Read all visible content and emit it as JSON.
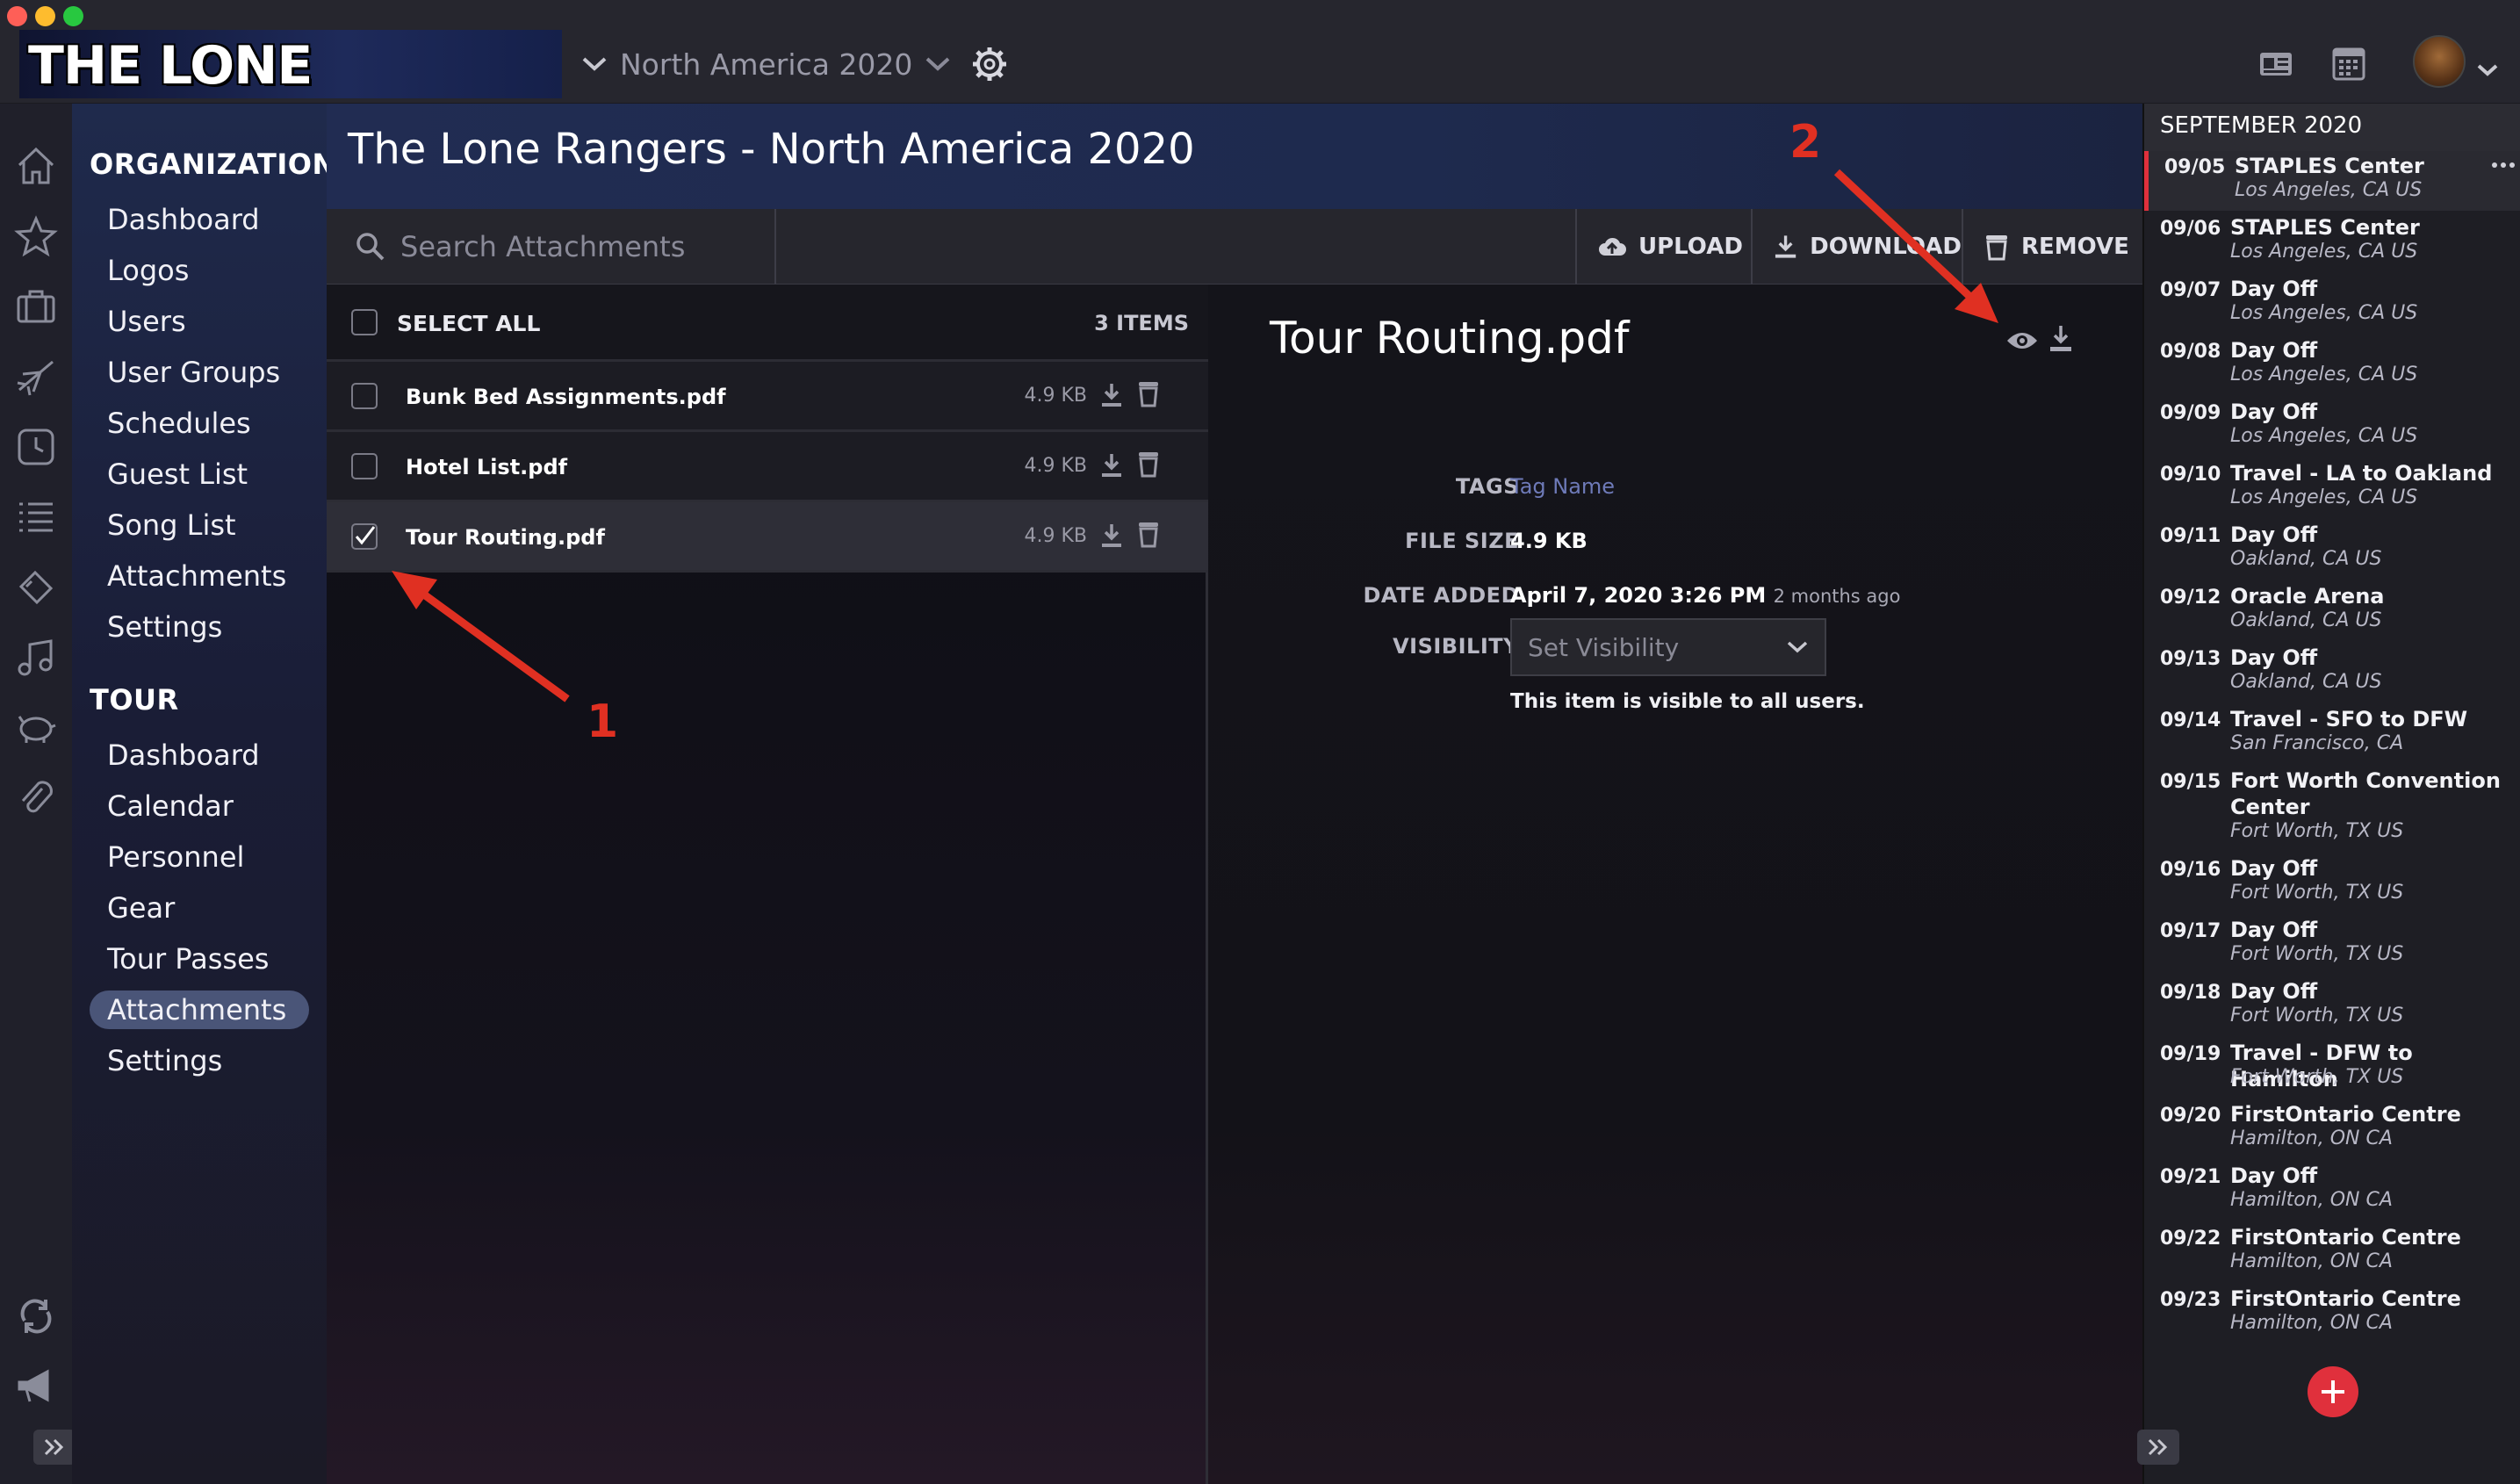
{
  "app": {
    "logo_text": "THE LONE RANGERS",
    "tour_selector": "North America 2020"
  },
  "nav": {
    "organization_heading": "ORGANIZATION",
    "organization_items": [
      "Dashboard",
      "Logos",
      "Users",
      "User Groups",
      "Schedules",
      "Guest List",
      "Song List",
      "Attachments",
      "Settings"
    ],
    "tour_heading": "TOUR",
    "tour_items": [
      "Dashboard",
      "Calendar",
      "Personnel",
      "Gear",
      "Tour Passes",
      "Attachments",
      "Settings"
    ],
    "active_item": "Attachments"
  },
  "header": {
    "title": "The Lone Rangers - North America 2020"
  },
  "toolbar": {
    "search_placeholder": "Search Attachments",
    "upload_label": "UPLOAD",
    "download_label": "DOWNLOAD",
    "remove_label": "REMOVE"
  },
  "list": {
    "select_all_label": "SELECT ALL",
    "items_count": "3 ITEMS",
    "files": [
      {
        "name": "Bunk Bed Assignments.pdf",
        "size": "4.9 KB",
        "checked": false
      },
      {
        "name": "Hotel List.pdf",
        "size": "4.9 KB",
        "checked": false
      },
      {
        "name": "Tour Routing.pdf",
        "size": "4.9 KB",
        "checked": true
      }
    ]
  },
  "detail": {
    "title": "Tour Routing.pdf",
    "tags_label": "TAGS",
    "tags_value": "Tag Name",
    "file_size_label": "FILE SIZE",
    "file_size_value": "4.9 KB",
    "date_added_label": "DATE ADDED",
    "date_added_value": "April 7, 2020 3:26 PM",
    "date_added_relative": "2 months ago",
    "visibility_label": "VISIBILITY",
    "visibility_placeholder": "Set Visibility",
    "visibility_note": "This item is visible to all users."
  },
  "schedule": {
    "month": "SEPTEMBER 2020",
    "events": [
      {
        "date": "09/05",
        "title": "STAPLES Center",
        "location": "Los Angeles, CA US",
        "selected": true
      },
      {
        "date": "09/06",
        "title": "STAPLES Center",
        "location": "Los Angeles, CA US"
      },
      {
        "date": "09/07",
        "title": "Day Off",
        "location": "Los Angeles, CA US"
      },
      {
        "date": "09/08",
        "title": "Day Off",
        "location": "Los Angeles, CA US"
      },
      {
        "date": "09/09",
        "title": "Day Off",
        "location": "Los Angeles, CA US"
      },
      {
        "date": "09/10",
        "title": "Travel - LA to Oakland",
        "location": "Los Angeles, CA US"
      },
      {
        "date": "09/11",
        "title": "Day Off",
        "location": "Oakland, CA US"
      },
      {
        "date": "09/12",
        "title": "Oracle Arena",
        "location": "Oakland, CA US"
      },
      {
        "date": "09/13",
        "title": "Day Off",
        "location": "Oakland, CA US"
      },
      {
        "date": "09/14",
        "title": "Travel - SFO to DFW",
        "location": "San Francisco, CA"
      },
      {
        "date": "09/15",
        "title": "Fort Worth Convention Center",
        "location": "Fort Worth, TX US"
      },
      {
        "date": "09/16",
        "title": "Day Off",
        "location": "Fort Worth, TX US"
      },
      {
        "date": "09/17",
        "title": "Day Off",
        "location": "Fort Worth, TX US"
      },
      {
        "date": "09/18",
        "title": "Day Off",
        "location": "Fort Worth, TX US"
      },
      {
        "date": "09/19",
        "title": "Travel - DFW to Hamilton",
        "location": "Fort Worth, TX US"
      },
      {
        "date": "09/20",
        "title": "FirstOntario Centre",
        "location": "Hamilton, ON CA"
      },
      {
        "date": "09/21",
        "title": "Day Off",
        "location": "Hamilton, ON CA"
      },
      {
        "date": "09/22",
        "title": "FirstOntario Centre",
        "location": "Hamilton, ON CA"
      },
      {
        "date": "09/23",
        "title": "FirstOntario Centre",
        "location": "Hamilton, ON CA"
      }
    ]
  },
  "annotations": {
    "first": "1",
    "second": "2"
  },
  "colors": {
    "accent_red": "#e03022",
    "active_nav": "#4a5578",
    "add_button": "#e0303c"
  },
  "icons": [
    "home-icon",
    "star-icon",
    "briefcase-icon",
    "plane-icon",
    "clock-icon",
    "list-icon",
    "ticket-icon",
    "music-icon",
    "piggy-bank-icon",
    "paperclip-icon",
    "sync-icon",
    "megaphone-icon",
    "gear-icon",
    "contact-card-icon",
    "calendar-icon",
    "eye-icon",
    "download-icon",
    "trash-icon",
    "upload-cloud-icon",
    "search-icon",
    "chevron-down-icon",
    "plus-icon",
    "more-icon"
  ]
}
